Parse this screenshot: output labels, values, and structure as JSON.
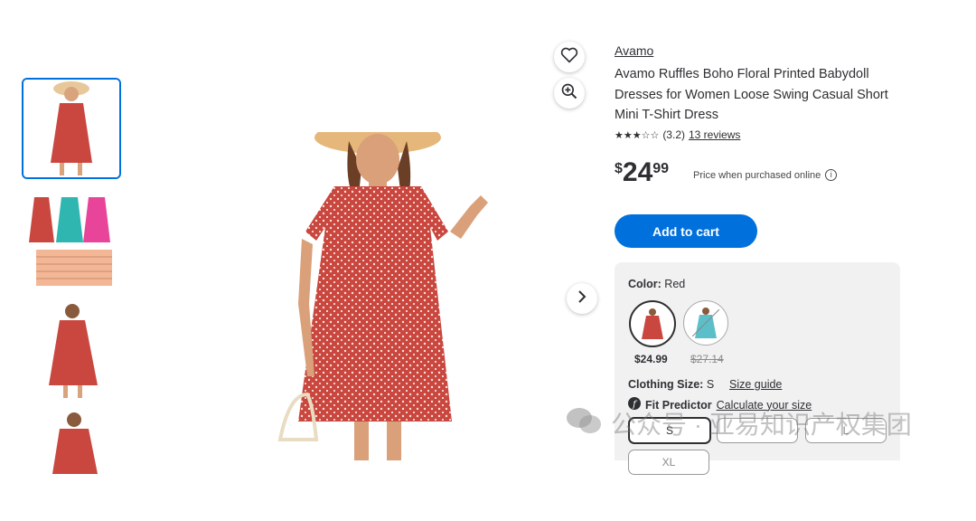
{
  "product": {
    "brand": "Avamo",
    "title": "Avamo Ruffles Boho Floral Printed Babydoll Dresses for Women Loose Swing Casual Short Mini T-Shirt Dress",
    "rating": {
      "stars": "★★★☆☆",
      "value": "(3.2)",
      "reviews": "13 reviews"
    },
    "price": {
      "currency": "$",
      "dollars": "24",
      "cents": "99",
      "note": "Price when purchased online",
      "info_icon": "ⓘ"
    },
    "add_to_cart": "Add to cart"
  },
  "options": {
    "color_label": "Color:",
    "color_value": "Red",
    "swatches": [
      {
        "price": "$24.99",
        "color": "#c9473f"
      },
      {
        "price": "$27.14",
        "color": "#5bbfc9"
      }
    ],
    "size_label": "Clothing Size:",
    "size_value": "S",
    "size_guide": "Size guide",
    "fit_label": "Fit Predictor",
    "fit_link": "Calculate your size",
    "sizes": [
      "S",
      "",
      "L",
      "XL"
    ]
  },
  "watermark": "公众号 · 亚易知识产权集团",
  "colors": {
    "accent": "#0071dc",
    "dress": "#c9473f"
  },
  "icons": [
    "heart-icon",
    "zoom-in-icon",
    "chevron-right-icon",
    "fit-predictor-icon",
    "wechat-icon"
  ]
}
